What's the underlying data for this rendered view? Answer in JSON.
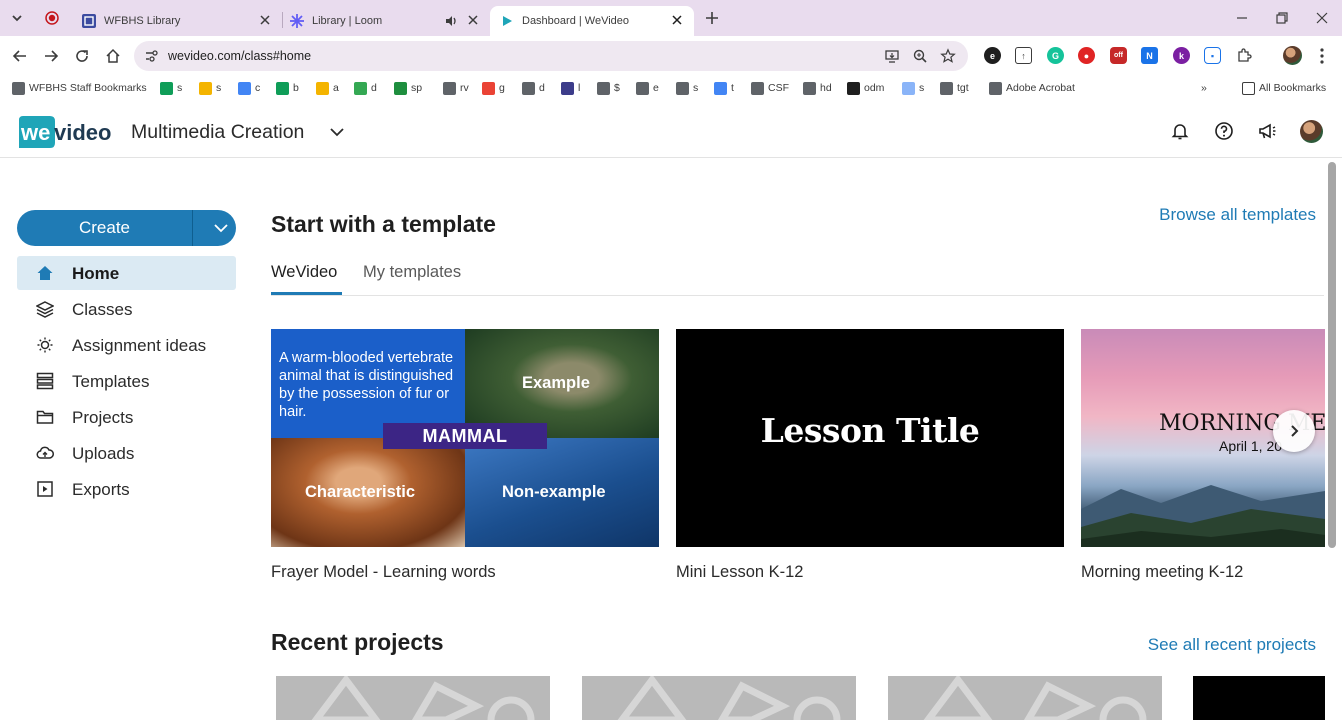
{
  "browser": {
    "tabs": [
      {
        "title": "WFBHS Library",
        "active": false
      },
      {
        "title": "Library | Loom",
        "active": false
      },
      {
        "title": "Dashboard | WeVideo",
        "active": true
      }
    ],
    "url": "wevideo.com/class#home",
    "bookmarks": [
      {
        "label": "WFBHS Staff Bookmarks",
        "color": "#5f6368"
      },
      {
        "label": "s",
        "color": "#0f9d58"
      },
      {
        "label": "s",
        "color": "#f4b400"
      },
      {
        "label": "c",
        "color": "#4285f4"
      },
      {
        "label": "b",
        "color": "#0f9d58"
      },
      {
        "label": "a",
        "color": "#f4b400"
      },
      {
        "label": "d",
        "color": "#34a853"
      },
      {
        "label": "sp",
        "color": "#1e8e3e"
      },
      {
        "label": "rv",
        "color": "#5f6368"
      },
      {
        "label": "g",
        "color": "#ea4335"
      },
      {
        "label": "d",
        "color": "#5f6368"
      },
      {
        "label": "l",
        "color": "#3c3c8a"
      },
      {
        "label": "$",
        "color": "#5f6368"
      },
      {
        "label": "e",
        "color": "#5f6368"
      },
      {
        "label": "s",
        "color": "#5f6368"
      },
      {
        "label": "t",
        "color": "#4285f4"
      },
      {
        "label": "CSF",
        "color": "#5f6368"
      },
      {
        "label": "hd",
        "color": "#5f6368"
      },
      {
        "label": "odm",
        "color": "#1f1f1f"
      },
      {
        "label": "s",
        "color": "#8ab4f8"
      },
      {
        "label": "tgt",
        "color": "#5f6368"
      },
      {
        "label": "Adobe Acrobat",
        "color": "#5f6368"
      }
    ],
    "all_bookmarks": "All Bookmarks",
    "ext_off_badge": "off",
    "ext_n": "N",
    "ext_k": "k"
  },
  "header": {
    "logo_text": "wevideo",
    "workspace": "Multimedia Creation"
  },
  "sidebar": {
    "create_label": "Create",
    "items": [
      {
        "label": "Home",
        "icon": "home-icon",
        "active": true
      },
      {
        "label": "Classes",
        "icon": "layers-icon"
      },
      {
        "label": "Assignment ideas",
        "icon": "lightbulb-icon"
      },
      {
        "label": "Templates",
        "icon": "templates-icon"
      },
      {
        "label": "Projects",
        "icon": "folder-icon"
      },
      {
        "label": "Uploads",
        "icon": "cloud-upload-icon"
      },
      {
        "label": "Exports",
        "icon": "export-icon"
      }
    ]
  },
  "templates": {
    "title": "Start with a template",
    "browse_link": "Browse all templates",
    "tabs": [
      "WeVideo",
      "My templates"
    ],
    "cards": [
      {
        "name": "Frayer Model - Learning words",
        "definition": "A warm-blooded vertebrate animal that is distinguished by the possession of fur or hair.",
        "example": "Example",
        "word": "MAMMAL",
        "characteristic": "Characteristic",
        "non_example": "Non-example"
      },
      {
        "name": "Mini Lesson K-12",
        "overlay": "Lesson Title"
      },
      {
        "name": "Morning meeting K-12",
        "overlay": "MORNING ME",
        "date": "April 1, 20"
      }
    ]
  },
  "recent": {
    "title": "Recent projects",
    "see_all_link": "See all recent projects"
  },
  "colors": {
    "accent": "#1f7bb5",
    "active_nav_bg": "#dbeaf3",
    "tabstrip": "#e9dcee"
  }
}
